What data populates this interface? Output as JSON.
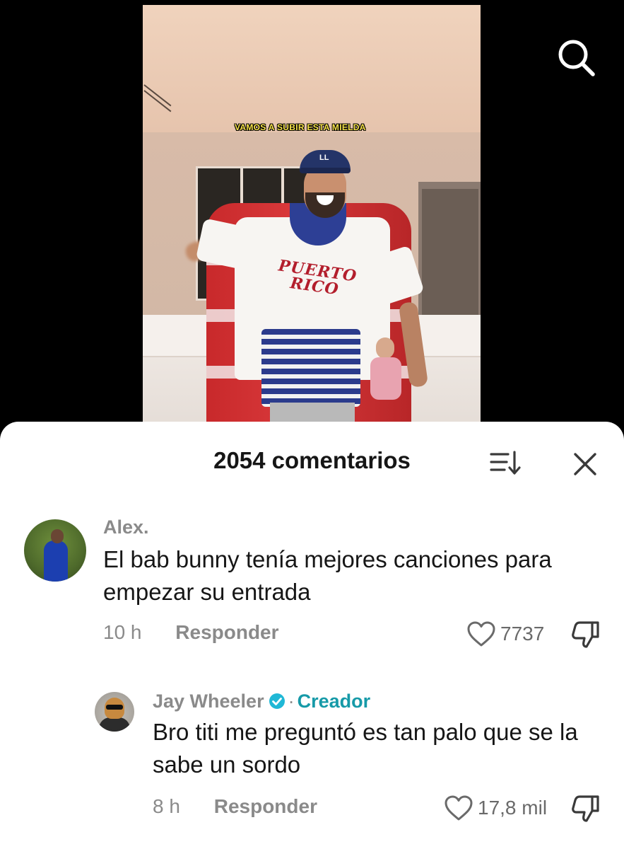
{
  "video": {
    "caption": "VAMOS A SUBIR ESTA MIELDA",
    "jersey_text_line1": "PUERTO",
    "jersey_text_line2": "RICO",
    "cap_logo": "LL"
  },
  "header": {
    "search_icon": "search-icon"
  },
  "comments_sheet": {
    "title": "2054 comentarios",
    "sort_icon": "sort-icon",
    "close_icon": "close-icon",
    "comments": [
      {
        "username": "Alex.",
        "text": "El bab bunny tenía mejores canciones para empezar su entrada",
        "time": "10 h",
        "reply_label": "Responder",
        "likes": "7737"
      },
      {
        "username": "Jay Wheeler",
        "verified": true,
        "separator": "·",
        "creator_label": "Creador",
        "text": "Bro titi me preguntó es tan palo que se la sabe un sordo",
        "time": "8 h",
        "reply_label": "Responder",
        "likes": "17,8 mil"
      }
    ]
  },
  "colors": {
    "creator_accent": "#169aa8",
    "verified_badge": "#20b8d6",
    "caption_yellow": "#f8e44a"
  }
}
